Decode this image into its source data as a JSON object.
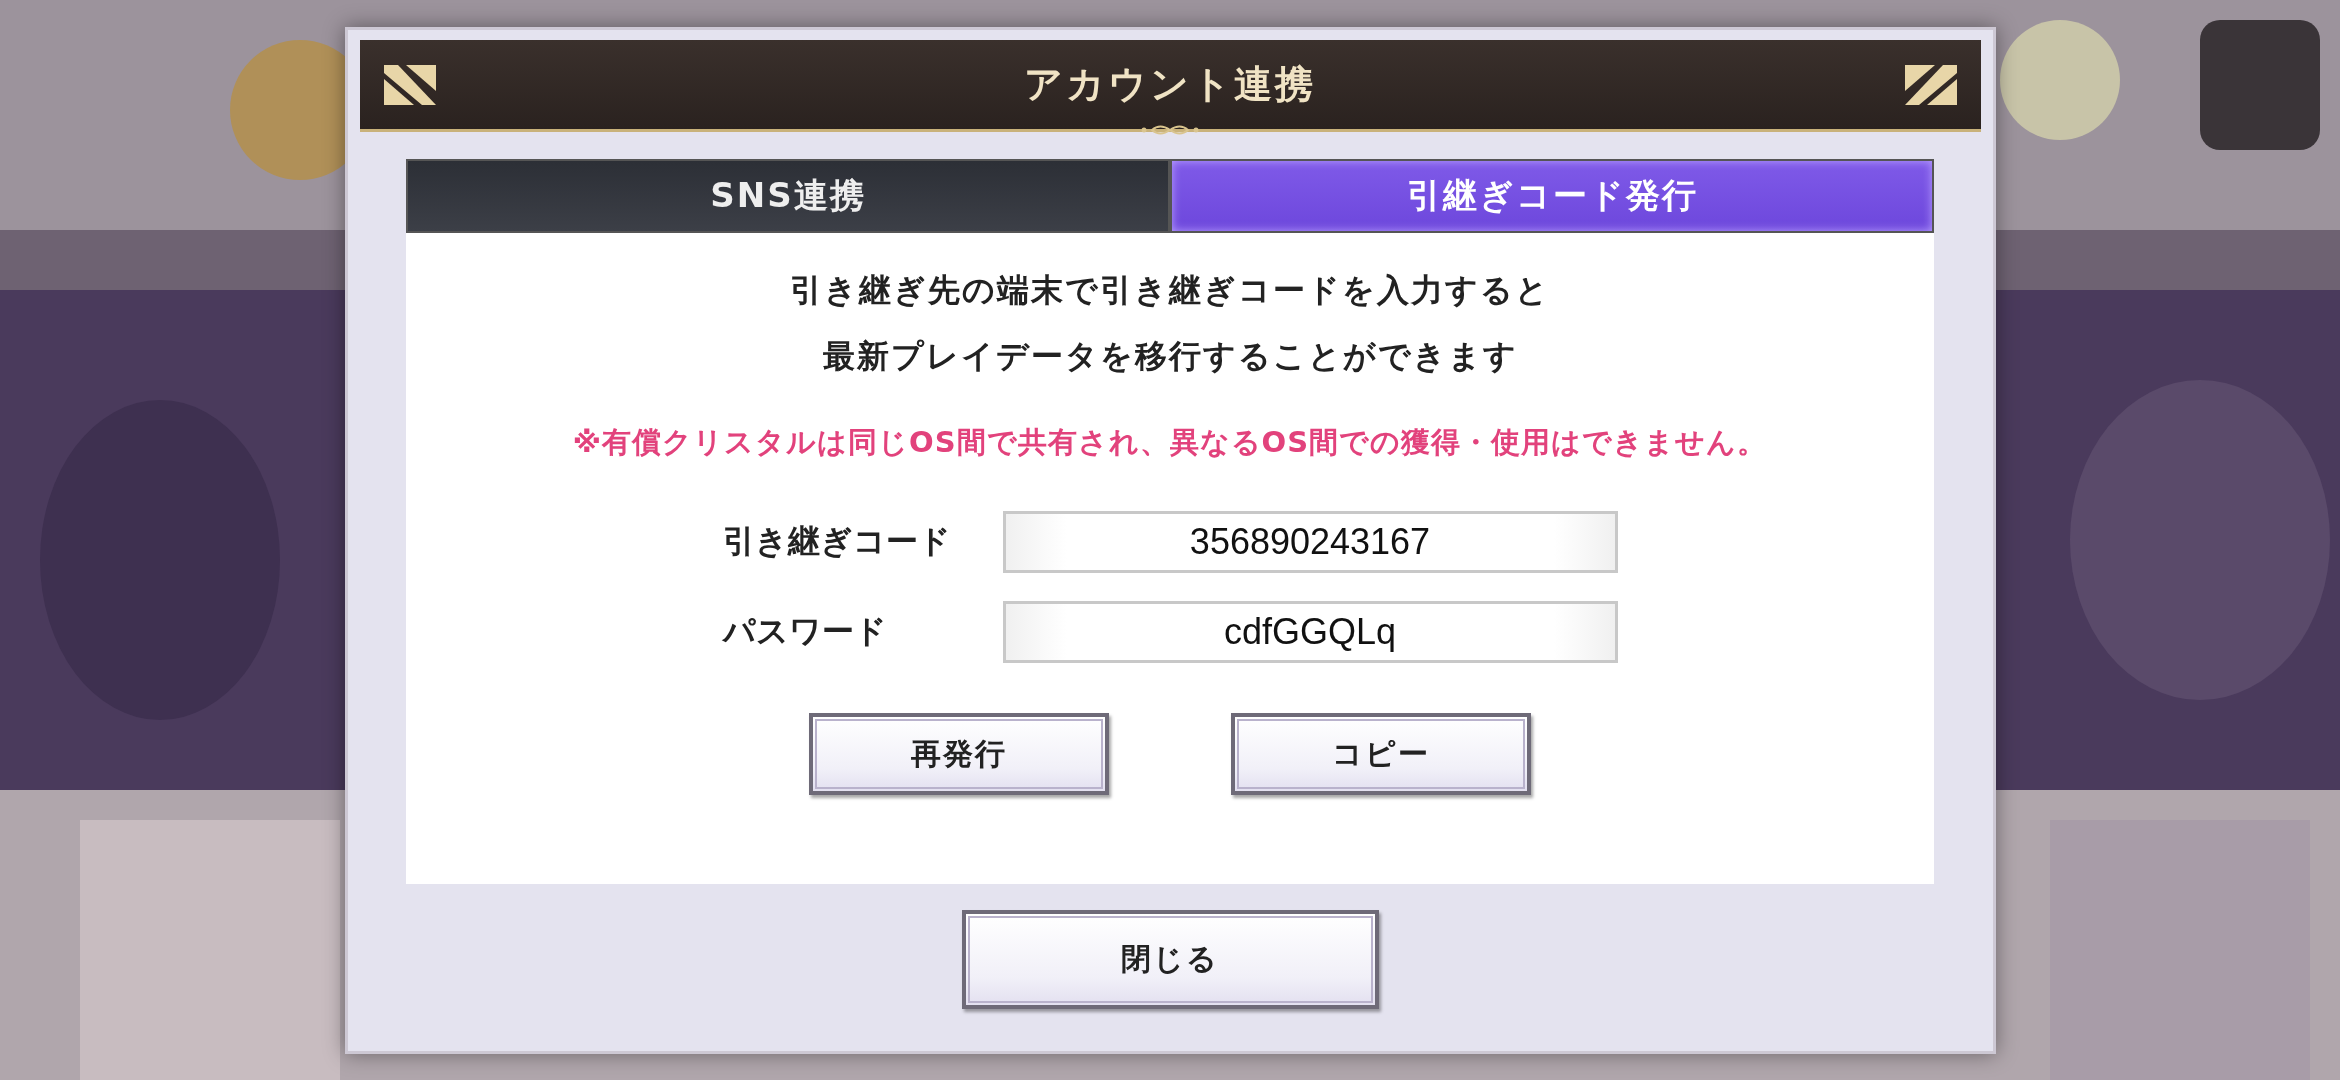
{
  "dialog": {
    "title": "アカウント連携"
  },
  "tabs": [
    {
      "label": "SNS連携",
      "selected": false
    },
    {
      "label": "引継ぎコード発行",
      "selected": true
    }
  ],
  "message": [
    "引き継ぎ先の端末で引き継ぎコードを入力すると",
    "最新プレイデータを移行することができます"
  ],
  "notice": "※有償クリスタルは同じOS間で共有され、異なるOS間での獲得・使用はできません。",
  "fields": [
    {
      "label": "引き継ぎコード",
      "value": "356890243167"
    },
    {
      "label": "パスワード",
      "value": "cdfGGQLq"
    }
  ],
  "actions": [
    "再発行",
    "コピー"
  ],
  "close_button": "閉じる"
}
